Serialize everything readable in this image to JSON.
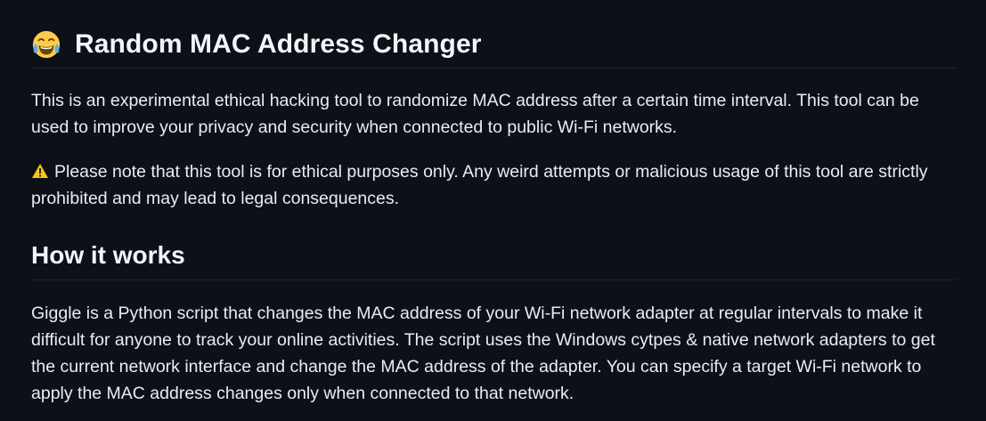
{
  "readme": {
    "title_icon": "tears-of-joy-emoji-icon",
    "title": "Random MAC Address Changer",
    "intro": "This is an experimental ethical hacking tool to randomize MAC address after a certain time interval. This tool can be used to improve your privacy and security when connected to public Wi-Fi networks.",
    "warning_icon": "warning-icon",
    "warning": "Please note that this tool is for ethical purposes only. Any weird attempts or malicious usage of this tool are strictly prohibited and may lead to legal consequences.",
    "section_heading": "How it works",
    "section_body": "Giggle is a Python script that changes the MAC address of your Wi-Fi network adapter at regular intervals to make it difficult for anyone to track your online activities. The script uses the Windows cytpes & native network adapters to get the current network interface and change the MAC address of the adapter. You can specify a target Wi-Fi network to apply the MAC address changes only when connected to that network."
  },
  "colors": {
    "background": "#0d1117",
    "text": "#e6edf3",
    "divider": "#21262d",
    "warning": "#f5c518"
  }
}
